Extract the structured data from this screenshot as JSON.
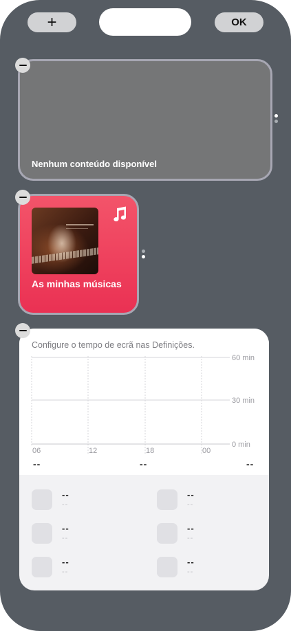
{
  "topbar": {
    "add_label": "+",
    "ok_label": "OK"
  },
  "widget_empty": {
    "message": "Nenhum conteúdo disponível"
  },
  "widget_music": {
    "title": "As minhas músicas",
    "icon": "music-note-icon",
    "accent": "#ee3f5c"
  },
  "widget_screen_time": {
    "hint": "Configure o tempo de ecrã nas Definições.",
    "y_ticks": [
      "60 min",
      "30 min",
      "0 min"
    ],
    "x_ticks": [
      "06",
      "12",
      "18",
      "00"
    ],
    "totals": [
      "--",
      "--",
      "--"
    ],
    "apps": [
      {
        "value": "--",
        "sub": "--"
      },
      {
        "value": "--",
        "sub": "--"
      },
      {
        "value": "--",
        "sub": "--"
      },
      {
        "value": "--",
        "sub": "--"
      },
      {
        "value": "--",
        "sub": "--"
      },
      {
        "value": "--",
        "sub": "--"
      }
    ]
  }
}
